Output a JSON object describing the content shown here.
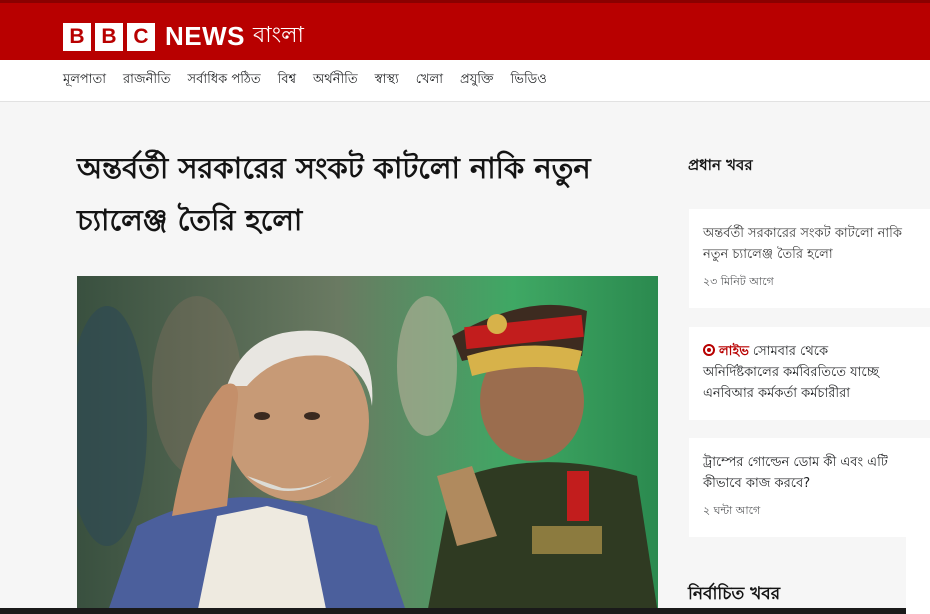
{
  "brand": {
    "letters": [
      "B",
      "B",
      "C"
    ],
    "news": "NEWS",
    "language": "বাংলা",
    "color": "#b80000"
  },
  "nav": [
    "মূলপাতা",
    "রাজনীতি",
    "সর্বাধিক পঠিত",
    "বিশ্ব",
    "অর্থনীতি",
    "স্বাস্থ্য",
    "খেলা",
    "প্রযুক্তি",
    "ভিডিও"
  ],
  "article": {
    "headline_line1": "অন্তর্বর্তী সরকারের সংকট কাটলো নাকি নতুন",
    "headline_line2": "চ্যালেঞ্জ তৈরি হলো",
    "image_icon": "news-photo"
  },
  "sidebar": {
    "title": "প্রধান খবর",
    "cards": [
      {
        "line1": "অন্তর্বর্তী সরকারের সংকট কাটলো নাকি",
        "line2": "নতুন চ্যালেঞ্জ তৈরি হলো",
        "time": "২৩ মিনিট আগে"
      },
      {
        "live": "লাইভ",
        "line1": "সোমবার থেকে",
        "line2": "অনির্দিষ্টকালের কর্মবিরতিতে যাচ্ছে",
        "line3": "এনবিআর কর্মকর্তা কর্মচারীরা"
      },
      {
        "line1": "ট্রাম্পের গোল্ডেন ডোম কী এবং এটি",
        "line2": "কীভাবে কাজ করবে?",
        "time": "২ ঘন্টা আগে"
      }
    ],
    "section2": "নির্বাচিত খবর"
  }
}
